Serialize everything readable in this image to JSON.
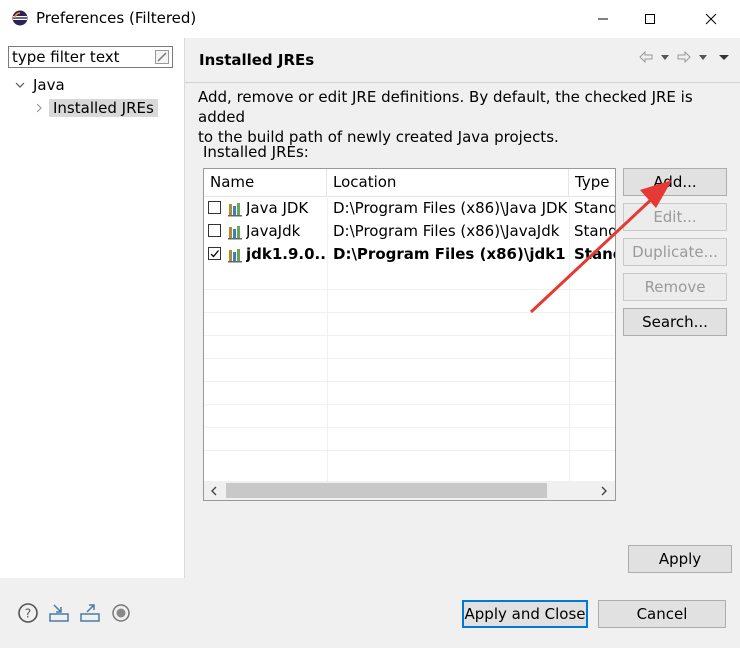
{
  "window": {
    "title": "Preferences (Filtered)",
    "app_icon": "eclipse-icon",
    "minimize_icon": "minimize-icon",
    "maximize_icon": "maximize-icon",
    "close_icon": "close-icon"
  },
  "filter": {
    "value": "type filter text",
    "clear_icon": "clear-filter-icon"
  },
  "tree": {
    "root": {
      "label": "Java",
      "expanded": true
    },
    "child": {
      "label": "Installed JREs",
      "selected": true
    }
  },
  "page": {
    "title": "Installed JREs",
    "description_line1": "Add, remove or edit JRE definitions. By default, the checked JRE is added",
    "description_line2": "to the build path of newly created Java projects.",
    "list_label": "Installed JREs:"
  },
  "table": {
    "columns": [
      "Name",
      "Location",
      "Type"
    ],
    "rows": [
      {
        "checked": false,
        "name": "Java JDK",
        "location": "D:\\Program Files (x86)\\Java JDK",
        "type": "Stand",
        "bold": false
      },
      {
        "checked": false,
        "name": "JavaJdk",
        "location": "D:\\Program Files (x86)\\JavaJdk",
        "type": "Stand",
        "bold": false
      },
      {
        "checked": true,
        "name": "jdk1.9.0...",
        "location": "D:\\Program Files (x86)\\jdk1....",
        "type": "Stand",
        "bold": true
      }
    ]
  },
  "buttons": {
    "add": "Add...",
    "edit": "Edit...",
    "duplicate": "Duplicate...",
    "remove": "Remove",
    "search": "Search...",
    "apply": "Apply",
    "apply_close": "Apply and Close",
    "cancel": "Cancel"
  },
  "colors": {
    "accent": "#0078d7",
    "annotation_arrow": "#e53935"
  }
}
